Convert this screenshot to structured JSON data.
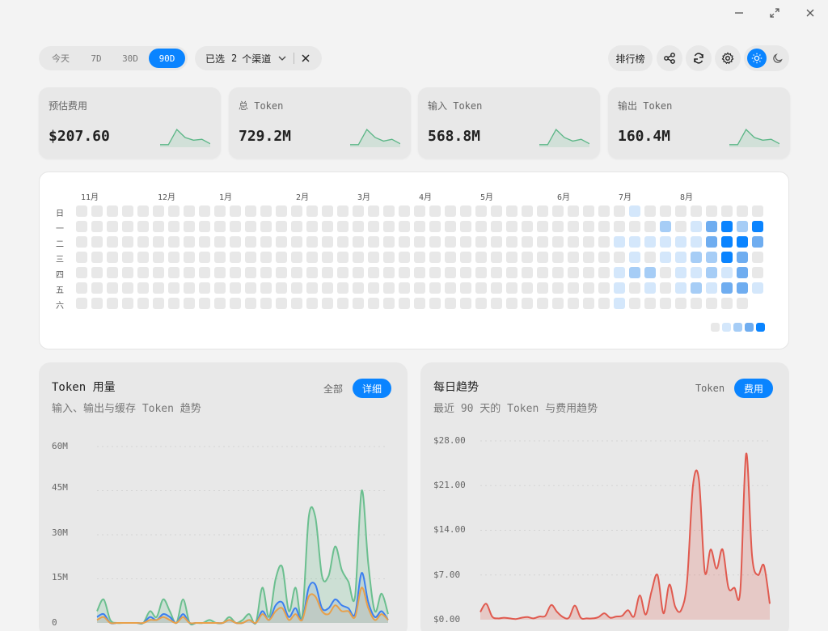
{
  "window": {
    "min_icon": "minimize-icon",
    "max_icon": "maximize-icon",
    "close_icon": "close-icon"
  },
  "toolbar": {
    "ranges": [
      "今天",
      "7D",
      "30D",
      "90D"
    ],
    "active_range": "90D",
    "channel_prefix": "已选",
    "channel_count": "2",
    "channel_suffix": "个渠道",
    "leaderboard": "排行榜"
  },
  "stats": [
    {
      "label": "预估费用",
      "value": "$207.60",
      "trend": [
        0.1,
        0.1,
        0.95,
        0.5,
        0.35,
        0.4,
        0.15
      ]
    },
    {
      "label": "总 Token",
      "value": "729.2M",
      "trend": [
        0.1,
        0.1,
        0.95,
        0.5,
        0.3,
        0.4,
        0.15
      ]
    },
    {
      "label": "输入 Token",
      "value": "568.8M",
      "trend": [
        0.1,
        0.1,
        0.95,
        0.5,
        0.3,
        0.4,
        0.15
      ]
    },
    {
      "label": "输出 Token",
      "value": "160.4M",
      "trend": [
        0.1,
        0.1,
        0.95,
        0.5,
        0.35,
        0.4,
        0.15
      ]
    }
  ],
  "heatmap": {
    "months": [
      "11月",
      "12月",
      "1月",
      "2月",
      "3月",
      "4月",
      "5月",
      "6月",
      "7月",
      "8月"
    ],
    "month_cols": [
      1,
      6,
      10,
      15,
      19,
      23,
      27,
      32,
      36,
      40
    ],
    "days": [
      "日",
      "一",
      "二",
      "三",
      "四",
      "五",
      "六"
    ],
    "weeks": 45,
    "active": {
      "36": [
        0,
        0,
        1,
        0,
        1,
        1,
        1
      ],
      "37": [
        1,
        0,
        1,
        1,
        2,
        0,
        0
      ],
      "38": [
        0,
        0,
        1,
        0,
        2,
        1,
        0
      ],
      "39": [
        0,
        2,
        1,
        1,
        0,
        0,
        0
      ],
      "40": [
        0,
        0,
        1,
        1,
        1,
        1,
        0
      ],
      "41": [
        0,
        1,
        1,
        2,
        1,
        2,
        0
      ],
      "42": [
        0,
        3,
        3,
        2,
        2,
        1,
        0
      ],
      "43": [
        0,
        4,
        4,
        4,
        1,
        3,
        0
      ],
      "44": [
        0,
        2,
        4,
        3,
        3,
        3,
        0
      ],
      "45": [
        0,
        4,
        3,
        0,
        0,
        1,
        -1
      ]
    },
    "palette": [
      "#e8e8e8",
      "#d4e7fb",
      "#a6cdf6",
      "#6fadf0",
      "#0a84ff"
    ]
  },
  "usage_panel": {
    "title": "Token 用量",
    "subtitle": "输入、输出与缓存 Token 趋势",
    "toggle_all": "全部",
    "toggle_detail": "详细",
    "yticks": [
      "60M",
      "45M",
      "30M",
      "15M",
      "0"
    ]
  },
  "trend_panel": {
    "title": "每日趋势",
    "subtitle": "最近 90 天的 Token 与费用趋势",
    "toggle_token": "Token",
    "toggle_cost": "费用",
    "yticks": [
      "$28.00",
      "$21.00",
      "$14.00",
      "$7.00",
      "$0.00"
    ]
  },
  "chart_data": [
    {
      "type": "area",
      "title": "Token 用量",
      "ylim": [
        0,
        60000000
      ],
      "series": [
        {
          "color": "#6bbf8f",
          "values": [
            4,
            8,
            1,
            0,
            0,
            0,
            0,
            0,
            4,
            2,
            8,
            4,
            0,
            8,
            0,
            0,
            0,
            1,
            0,
            0,
            2,
            0,
            1,
            3,
            0,
            12,
            2,
            15,
            19,
            4,
            12,
            2,
            36,
            36,
            16,
            16,
            26,
            18,
            14,
            9,
            45,
            20,
            4,
            10,
            3
          ]
        },
        {
          "color": "#3b7ff0",
          "values": [
            2,
            3,
            0,
            0,
            0,
            0,
            0,
            0,
            2,
            1,
            3,
            2,
            0,
            3,
            0,
            0,
            0,
            0,
            0,
            0,
            1,
            0,
            0,
            1,
            0,
            4,
            1,
            6,
            7,
            2,
            5,
            1,
            12,
            13,
            5,
            5,
            8,
            6,
            5,
            3,
            17,
            7,
            2,
            4,
            1
          ]
        },
        {
          "color": "#e8a04a",
          "values": [
            1,
            2,
            0,
            0,
            0,
            0,
            0,
            0,
            1,
            1,
            2,
            1,
            0,
            2,
            0,
            0,
            0,
            0,
            0,
            0,
            1,
            0,
            0,
            1,
            0,
            3,
            1,
            4,
            5,
            1,
            3,
            1,
            9,
            9,
            4,
            3,
            6,
            4,
            4,
            2,
            12,
            5,
            1,
            3,
            1
          ]
        }
      ]
    },
    {
      "type": "area",
      "title": "每日趋势",
      "ylim": [
        0,
        28
      ],
      "series": [
        {
          "color": "#e05a4f",
          "values": [
            1.2,
            2.5,
            0.5,
            0.2,
            0.3,
            0.2,
            0.1,
            0.3,
            0.4,
            0.2,
            0.5,
            0.6,
            2.3,
            1.2,
            0.4,
            0.3,
            2.2,
            0.3,
            0.2,
            0.2,
            0.4,
            1.0,
            0.3,
            0.5,
            0.6,
            1.5,
            0.5,
            3.8,
            0.8,
            4.5,
            7.0,
            1.0,
            5.5,
            2.0,
            1.5,
            6.0,
            21.0,
            22.0,
            7.5,
            11.0,
            8.0,
            11.0,
            5.0,
            5.0,
            4.5,
            26.0,
            10.0,
            7.0,
            8.5,
            2.5
          ]
        }
      ]
    }
  ]
}
